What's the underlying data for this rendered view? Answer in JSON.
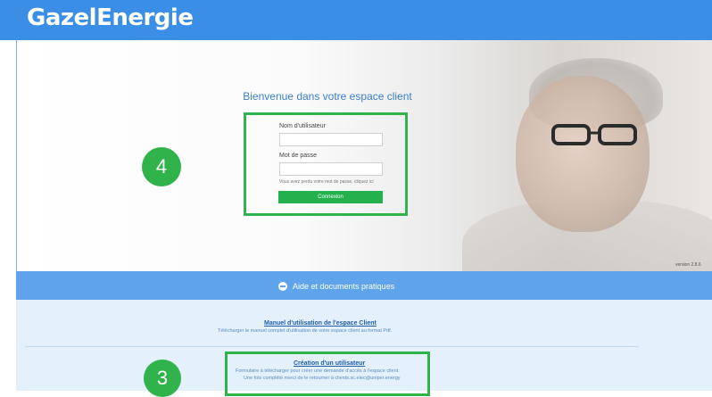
{
  "header": {
    "logo_text": "GazelEnergie",
    "color": "#3b8ee6"
  },
  "login": {
    "welcome": "Bienvenue dans votre espace client",
    "username_label": "Nom d'utilisateur",
    "password_label": "Mot de passe",
    "forgot_text": "Vous avez perdu votre mot de passe, cliquez ici",
    "submit_label": "Connexion",
    "username_value": "",
    "password_value": ""
  },
  "version": "version 2.8.6",
  "help": {
    "title": "Aide et documents pratiques",
    "icon": "minus-circle-icon",
    "documents": [
      {
        "title": "Manuel d'utilisation de l'espace Client",
        "description": "Télécharger le manuel complet d'utilisation de votre espace client au format Pdf."
      },
      {
        "title": "Création d'un utilisateur",
        "description_line1": "Formulaire à télécharger pour créer une demande d'accès à l'espace client.",
        "description_line2": "Une fois complété merci de le retourner à clients.sc.elec@uniper.energy"
      }
    ]
  },
  "annotations": {
    "badge_login": "4",
    "badge_create": "3",
    "highlight_color": "#2fb34a"
  }
}
